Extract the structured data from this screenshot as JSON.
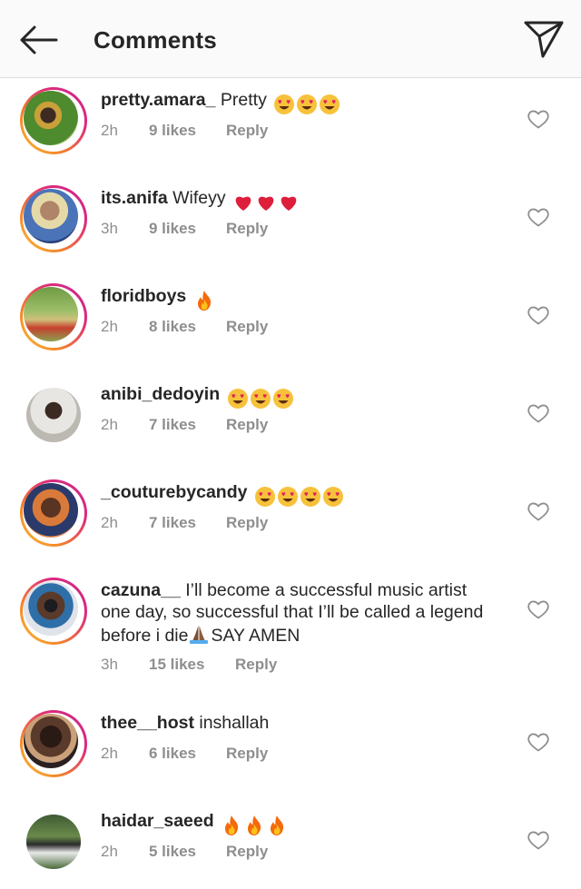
{
  "header": {
    "title": "Comments",
    "back_icon": "arrow-left-icon",
    "send_icon": "paper-plane-icon"
  },
  "colors": {
    "story_ring_start": "#f9c43a",
    "story_ring_end": "#c7268f",
    "meta_text": "#8e8e8e",
    "emoji_face": "#f7c23b",
    "emoji_heart": "#e0245e",
    "fire": "#f46a0c"
  },
  "comments": [
    {
      "username": "pretty.amara_",
      "text": "Pretty",
      "emoji": [
        "heart-eyes",
        "heart-eyes",
        "heart-eyes"
      ],
      "time": "2h",
      "likes": "9 likes",
      "reply": "Reply",
      "story_ring": true
    },
    {
      "username": "its.anifa",
      "text": "Wifeyy",
      "emoji": [
        "red-heart",
        "red-heart",
        "red-heart"
      ],
      "time": "3h",
      "likes": "9 likes",
      "reply": "Reply",
      "story_ring": true
    },
    {
      "username": "floridboys",
      "text": "",
      "emoji": [
        "fire"
      ],
      "time": "2h",
      "likes": "8 likes",
      "reply": "Reply",
      "story_ring": true
    },
    {
      "username": "anibi_dedoyin",
      "text": "",
      "emoji": [
        "heart-eyes",
        "heart-eyes",
        "heart-eyes"
      ],
      "time": "2h",
      "likes": "7 likes",
      "reply": "Reply",
      "story_ring": false
    },
    {
      "username": "_couturebycandy",
      "text": "",
      "emoji": [
        "heart-eyes",
        "heart-eyes",
        "heart-eyes",
        "heart-eyes"
      ],
      "time": "2h",
      "likes": "7 likes",
      "reply": "Reply",
      "story_ring": true
    },
    {
      "username": "cazuna__",
      "text_line1": "I’ll become a successful music artist",
      "text_line2": "one day, so successful that I’ll be called a legend",
      "text_line3a": "before i die",
      "text_line3b": "SAY AMEN",
      "emoji": [
        "folded-hands"
      ],
      "time": "3h",
      "likes": "15 likes",
      "reply": "Reply",
      "story_ring": true
    },
    {
      "username": "thee__host",
      "text": "inshallah",
      "emoji": [],
      "time": "2h",
      "likes": "6 likes",
      "reply": "Reply",
      "story_ring": true
    },
    {
      "username": "haidar_saeed",
      "text": "",
      "emoji": [
        "fire",
        "fire",
        "fire"
      ],
      "time": "2h",
      "likes": "5 likes",
      "reply": "Reply",
      "story_ring": false
    }
  ]
}
